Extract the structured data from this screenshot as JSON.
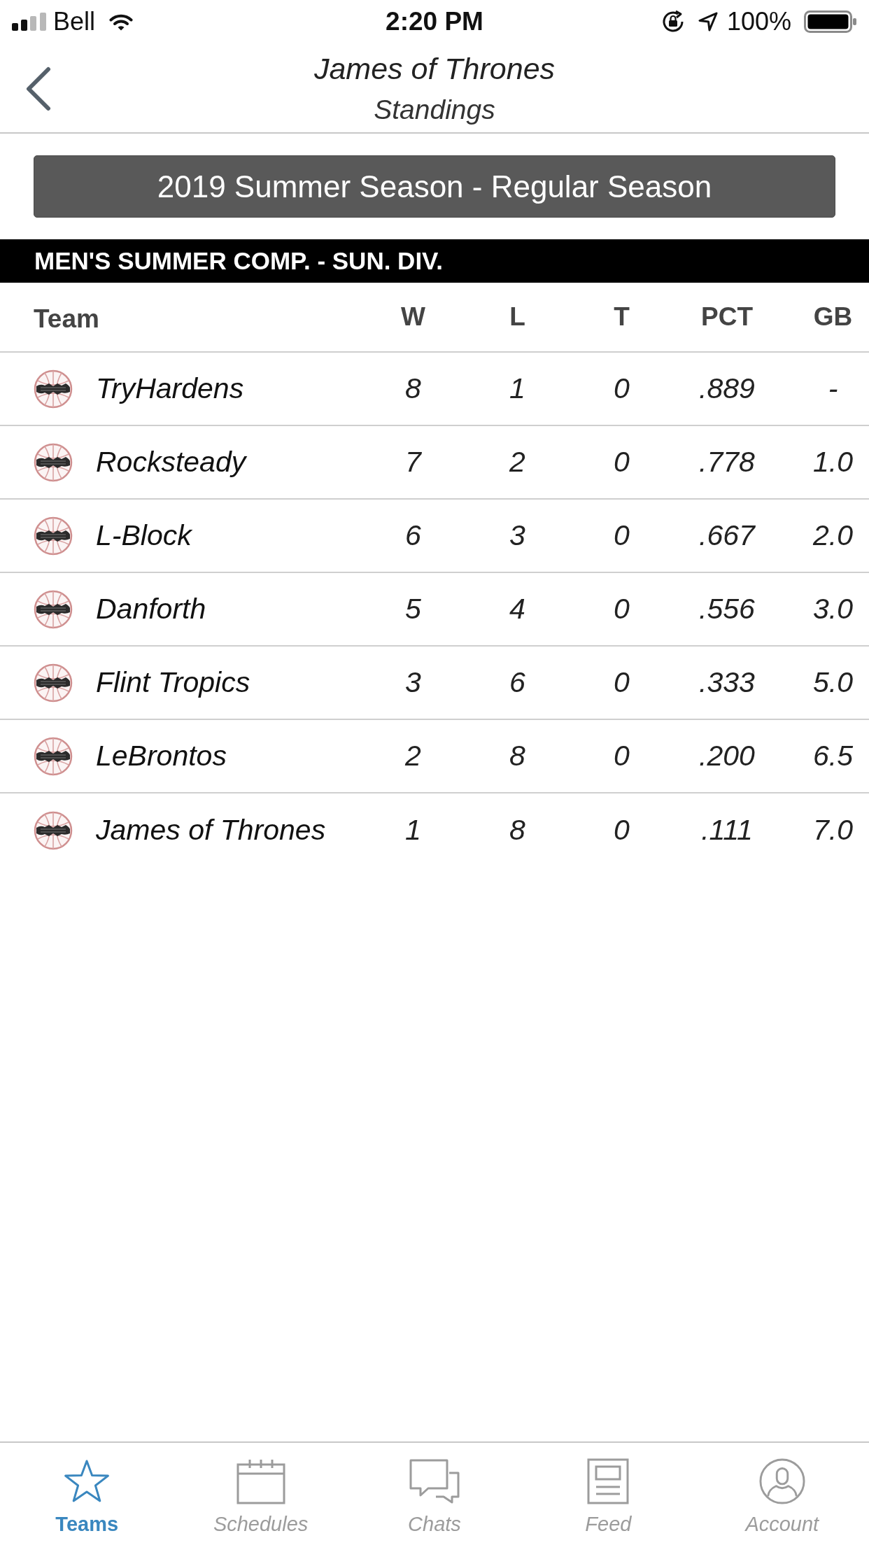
{
  "status_bar": {
    "carrier": "Bell",
    "time": "2:20 PM",
    "battery": "100%"
  },
  "header": {
    "title": "James of Thrones",
    "subtitle": "Standings"
  },
  "season_selector": {
    "label": "2019 Summer Season - Regular Season"
  },
  "division": {
    "title": "MEN'S SUMMER COMP. - SUN. DIV."
  },
  "standings": {
    "columns": [
      "Team",
      "W",
      "L",
      "T",
      "PCT",
      "GB"
    ],
    "rows": [
      {
        "team": "TryHardens",
        "stats": [
          "8",
          "1",
          "0",
          ".889",
          "-"
        ]
      },
      {
        "team": "Rocksteady",
        "stats": [
          "7",
          "2",
          "0",
          ".778",
          "1.0"
        ]
      },
      {
        "team": "L-Block",
        "stats": [
          "6",
          "3",
          "0",
          ".667",
          "2.0"
        ]
      },
      {
        "team": "Danforth",
        "stats": [
          "5",
          "4",
          "0",
          ".556",
          "3.0"
        ]
      },
      {
        "team": "Flint Tropics",
        "stats": [
          "3",
          "6",
          "0",
          ".333",
          "5.0"
        ]
      },
      {
        "team": "LeBrontos",
        "stats": [
          "2",
          "8",
          "0",
          ".200",
          "6.5"
        ]
      },
      {
        "team": "James of Thrones",
        "stats": [
          "1",
          "8",
          "0",
          ".111",
          "7.0"
        ]
      }
    ]
  },
  "tab_bar": {
    "tabs": [
      {
        "label": "Teams",
        "selected": true
      },
      {
        "label": "Schedules",
        "selected": false
      },
      {
        "label": "Chats",
        "selected": false
      },
      {
        "label": "Feed",
        "selected": false
      },
      {
        "label": "Account",
        "selected": false
      }
    ]
  }
}
